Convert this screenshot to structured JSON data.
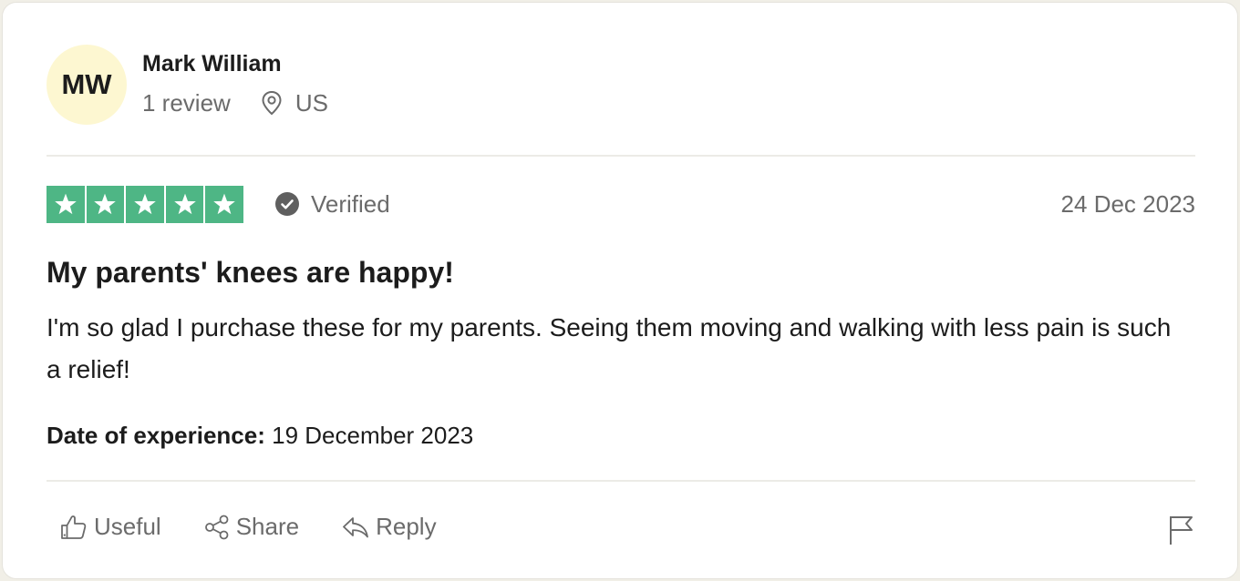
{
  "consumer": {
    "initials": "MW",
    "name": "Mark William",
    "reviews_count_label": "1 review",
    "location": "US"
  },
  "review": {
    "rating": 5,
    "rating_max": 5,
    "verified_label": "Verified",
    "date": "24 Dec 2023",
    "title": "My parents' knees are happy!",
    "body": "I'm so glad I purchase these for my parents. Seeing them moving and walking with less pain is such a relief!",
    "experience_label": "Date of experience:",
    "experience_date": "19 December 2023"
  },
  "actions": {
    "useful_label": "Useful",
    "share_label": "Share",
    "reply_label": "Reply"
  },
  "colors": {
    "star_green": "#4eb685",
    "avatar_bg": "#fdf7d1",
    "muted_text": "#6b6b6b"
  },
  "icons": {
    "location": "map-pin-icon",
    "verified": "check-circle-icon",
    "useful": "thumbs-up-icon",
    "share": "share-icon",
    "reply": "reply-icon",
    "report": "flag-icon"
  }
}
